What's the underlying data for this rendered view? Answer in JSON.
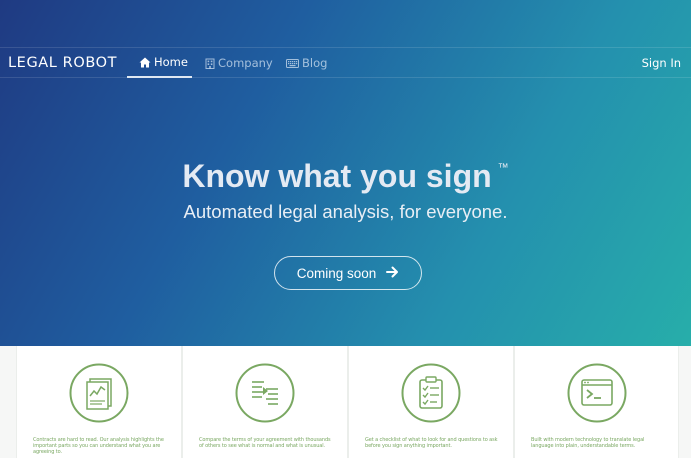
{
  "nav": {
    "brand": "LEGAL ROBOT",
    "items": [
      {
        "label": "Home",
        "icon": "home-icon",
        "active": true
      },
      {
        "label": "Company",
        "icon": "building-icon",
        "active": false
      },
      {
        "label": "Blog",
        "icon": "keyboard-icon",
        "active": false
      }
    ],
    "signin": "Sign In"
  },
  "hero": {
    "headline": "Know what you sign",
    "trademark": "™",
    "subheadline": "Automated legal analysis, for everyone.",
    "cta_label": "Coming soon",
    "cta_icon": "arrow-right-icon"
  },
  "features": [
    {
      "icon": "chart-report-icon",
      "blurb": "Contracts are hard to read. Our analysis highlights the important parts so you can understand what you are agreeing to."
    },
    {
      "icon": "document-list-icon",
      "blurb": "Compare the terms of your agreement with thousands of others to see what is normal and what is unusual."
    },
    {
      "icon": "clipboard-checklist-icon",
      "blurb": "Get a checklist of what to look for and questions to ask before you sign anything important."
    },
    {
      "icon": "terminal-window-icon",
      "blurb": "Built with modern technology to translate legal language into plain, understandable terms."
    }
  ],
  "colors": {
    "gradient_start": "#1f3a82",
    "gradient_end": "#27aeaa",
    "icon_green": "#7aa862",
    "headline": "#e4eaf3"
  }
}
